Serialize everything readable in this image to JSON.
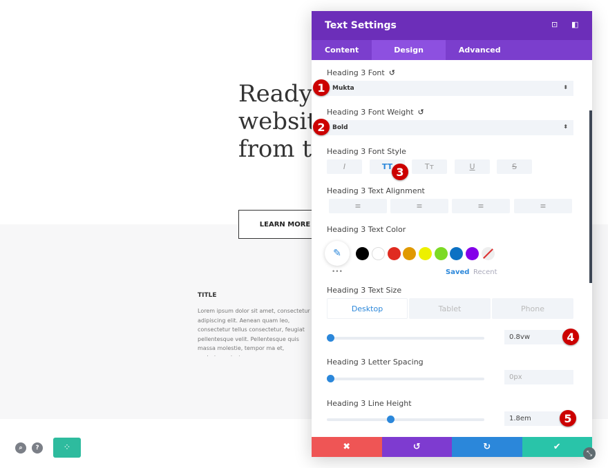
{
  "page": {
    "hero_lines": [
      "Ready t",
      "website",
      "from th"
    ],
    "learn_more": "LEARN MORE",
    "title": "TITLE",
    "lorem": "Lorem ipsum dolor sit amet, consectetur adipiscing elit. Aenean quam leo, consectetur tellus consectetur, feugiat pellentesque velit. Pellentesque quis massa molestie, tempor ma et, scelerisque justo."
  },
  "panel": {
    "title": "Text Settings",
    "tabs": [
      "Content",
      "Design",
      "Advanced"
    ],
    "active_tab": "Design",
    "font": {
      "label": "Heading 3 Font",
      "value": "Mukta"
    },
    "weight": {
      "label": "Heading 3 Font Weight",
      "value": "Bold"
    },
    "style": {
      "label": "Heading 3 Font Style",
      "buttons": [
        "I",
        "TT",
        "Tт",
        "U",
        "S"
      ],
      "active": "TT"
    },
    "alignment": {
      "label": "Heading 3 Text Alignment",
      "options": [
        "left",
        "center",
        "right",
        "justify"
      ]
    },
    "color": {
      "label": "Heading 3 Text Color",
      "swatches": [
        "#000000",
        "#ffffff",
        "#e02b20",
        "#e09900",
        "#edf000",
        "#7cda24",
        "#0c71c3",
        "#8300e9"
      ],
      "saved": "Saved",
      "recent": "Recent",
      "more": "•••"
    },
    "size": {
      "label": "Heading 3 Text Size",
      "devices": [
        "Desktop",
        "Tablet",
        "Phone"
      ],
      "active_device": "Desktop",
      "value": "0.8vw"
    },
    "letter_spacing": {
      "label": "Heading 3 Letter Spacing",
      "value": "0px"
    },
    "line_height": {
      "label": "Heading 3 Line Height",
      "value": "1.8em"
    },
    "footer": {
      "cancel": "✖",
      "undo": "↺",
      "redo": "↻",
      "save": "✔"
    },
    "badges": [
      "1",
      "2",
      "3",
      "4",
      "5"
    ]
  },
  "colors": {
    "header": "#6c2eb9",
    "tabs": "#7b3ecd",
    "cancel": "#ef5555",
    "undo": "#7e3bd0",
    "redo": "#2b87da",
    "save": "#29c4a9"
  }
}
